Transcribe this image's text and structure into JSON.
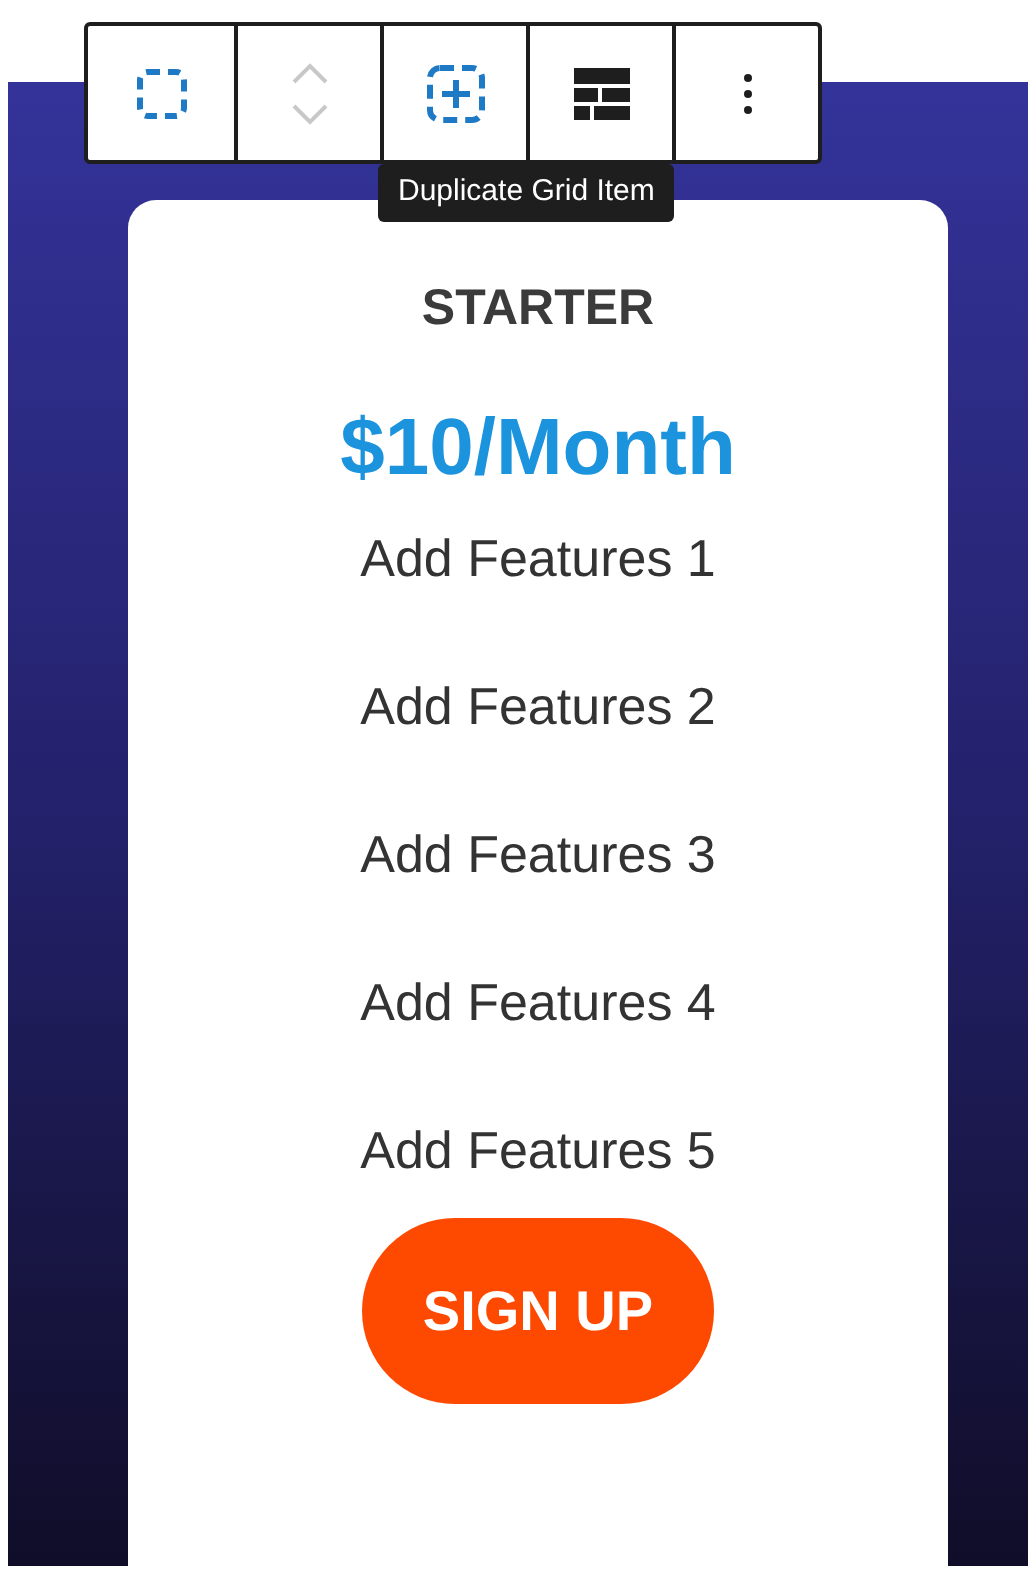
{
  "toolbar": {
    "buttons": [
      {
        "kind": "select-parent",
        "disabled": false
      },
      {
        "kind": "mover",
        "disabled": true
      },
      {
        "kind": "duplicate",
        "disabled": false
      },
      {
        "kind": "layout",
        "disabled": false
      },
      {
        "kind": "more",
        "disabled": false
      }
    ],
    "tooltip": "Duplicate Grid Item"
  },
  "card": {
    "plan": "STARTER",
    "price": "$10/Month",
    "features": [
      "Add Features 1",
      "Add Features 2",
      "Add Features 3",
      "Add Features 4",
      "Add Features 5"
    ],
    "button": "SIGN UP"
  }
}
